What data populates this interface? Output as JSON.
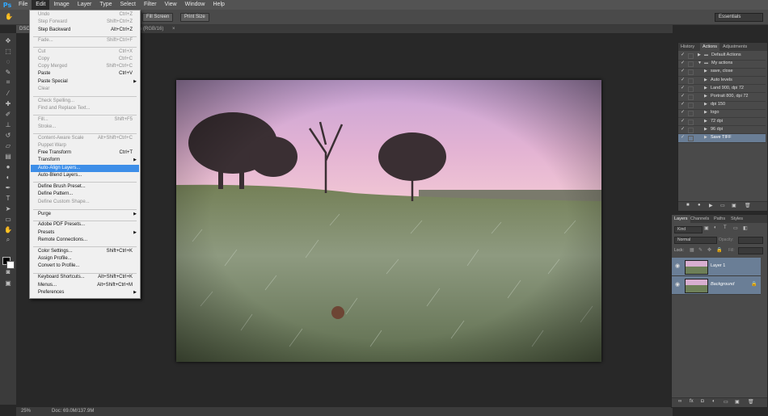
{
  "app": {
    "logo": "Ps"
  },
  "menubar": {
    "items": [
      "File",
      "Edit",
      "Image",
      "Layer",
      "Type",
      "Select",
      "Filter",
      "View",
      "Window",
      "Help"
    ],
    "active": "Edit"
  },
  "optionsbar": {
    "fill_screen_label": "Fill Screen",
    "print_size_label": "Print Size",
    "workspace": "Essentials"
  },
  "document": {
    "tab_prefix": "DSC",
    "tab_suffix": "% (RGB/16)"
  },
  "status": {
    "zoom": "25%",
    "doc_size": "Doc: 69.0M/137.9M"
  },
  "edit_menu": {
    "items": [
      {
        "label": "Undo",
        "shortcut": "Ctrl+Z",
        "disabled": true
      },
      {
        "label": "Step Forward",
        "shortcut": "Shift+Ctrl+Z",
        "disabled": true
      },
      {
        "label": "Step Backward",
        "shortcut": "Alt+Ctrl+Z",
        "disabled": false
      },
      {
        "label": "Fade...",
        "shortcut": "Shift+Ctrl+F",
        "disabled": true
      },
      {
        "label": "Cut",
        "shortcut": "Ctrl+X",
        "disabled": true
      },
      {
        "label": "Copy",
        "shortcut": "Ctrl+C",
        "disabled": true
      },
      {
        "label": "Copy Merged",
        "shortcut": "Shift+Ctrl+C",
        "disabled": true
      },
      {
        "label": "Paste",
        "shortcut": "Ctrl+V",
        "disabled": false
      },
      {
        "label": "Paste Special",
        "shortcut": "",
        "disabled": false,
        "submenu": true
      },
      {
        "label": "Clear",
        "shortcut": "",
        "disabled": true
      },
      {
        "label": "Check Spelling...",
        "shortcut": "",
        "disabled": true
      },
      {
        "label": "Find and Replace Text...",
        "shortcut": "",
        "disabled": true
      },
      {
        "label": "Fill...",
        "shortcut": "Shift+F5",
        "disabled": true
      },
      {
        "label": "Stroke...",
        "shortcut": "",
        "disabled": true
      },
      {
        "label": "Content-Aware Scale",
        "shortcut": "Alt+Shift+Ctrl+C",
        "disabled": true
      },
      {
        "label": "Puppet Warp",
        "shortcut": "",
        "disabled": true
      },
      {
        "label": "Free Transform",
        "shortcut": "Ctrl+T",
        "disabled": false
      },
      {
        "label": "Transform",
        "shortcut": "",
        "disabled": false,
        "submenu": true
      },
      {
        "label": "Auto-Align Layers...",
        "shortcut": "",
        "disabled": false,
        "highlighted": true
      },
      {
        "label": "Auto-Blend Layers...",
        "shortcut": "",
        "disabled": false
      },
      {
        "label": "Define Brush Preset...",
        "shortcut": "",
        "disabled": false
      },
      {
        "label": "Define Pattern...",
        "shortcut": "",
        "disabled": false
      },
      {
        "label": "Define Custom Shape...",
        "shortcut": "",
        "disabled": true
      },
      {
        "label": "Purge",
        "shortcut": "",
        "disabled": false,
        "submenu": true
      },
      {
        "label": "Adobe PDF Presets...",
        "shortcut": "",
        "disabled": false
      },
      {
        "label": "Presets",
        "shortcut": "",
        "disabled": false,
        "submenu": true
      },
      {
        "label": "Remote Connections...",
        "shortcut": "",
        "disabled": false
      },
      {
        "label": "Color Settings...",
        "shortcut": "Shift+Ctrl+K",
        "disabled": false
      },
      {
        "label": "Assign Profile...",
        "shortcut": "",
        "disabled": false
      },
      {
        "label": "Convert to Profile...",
        "shortcut": "",
        "disabled": false
      },
      {
        "label": "Keyboard Shortcuts...",
        "shortcut": "Alt+Shift+Ctrl+K",
        "disabled": false
      },
      {
        "label": "Menus...",
        "shortcut": "Alt+Shift+Ctrl+M",
        "disabled": false
      },
      {
        "label": "Preferences",
        "shortcut": "",
        "disabled": false,
        "submenu": true
      }
    ]
  },
  "actions_panel": {
    "tabs": [
      "History",
      "Actions",
      "Adjustments"
    ],
    "active_tab": "Actions",
    "rows": [
      {
        "label": "Default Actions",
        "level": 0,
        "folder": true
      },
      {
        "label": "My actions",
        "level": 0,
        "folder": true,
        "open": true
      },
      {
        "label": "save, close",
        "level": 1
      },
      {
        "label": "Auto levels",
        "level": 1
      },
      {
        "label": "Land 900, dpi 72",
        "level": 1
      },
      {
        "label": "Portrait 800, dpi 72",
        "level": 1
      },
      {
        "label": "dpi 150",
        "level": 1
      },
      {
        "label": "logo",
        "level": 1
      },
      {
        "label": "72 dpi",
        "level": 1
      },
      {
        "label": "96 dpi",
        "level": 1
      },
      {
        "label": "Save TIFF",
        "level": 1,
        "selected": true
      }
    ]
  },
  "layers_panel": {
    "tabs": [
      "Layers",
      "Channels",
      "Paths",
      "Styles"
    ],
    "active_tab": "Layers",
    "kind_label": "Kind",
    "blend_mode": "Normal",
    "opacity_label": "Opacity:",
    "lock_label": "Lock:",
    "fill_label": "Fill:",
    "layers": [
      {
        "name": "Layer 1",
        "italic": false
      },
      {
        "name": "Background",
        "italic": true
      }
    ]
  },
  "colors": {
    "menubar": "#535353",
    "highlight": "#3d8ee8",
    "panel": "#4a4a4a",
    "selected_row": "#6a7e96"
  }
}
